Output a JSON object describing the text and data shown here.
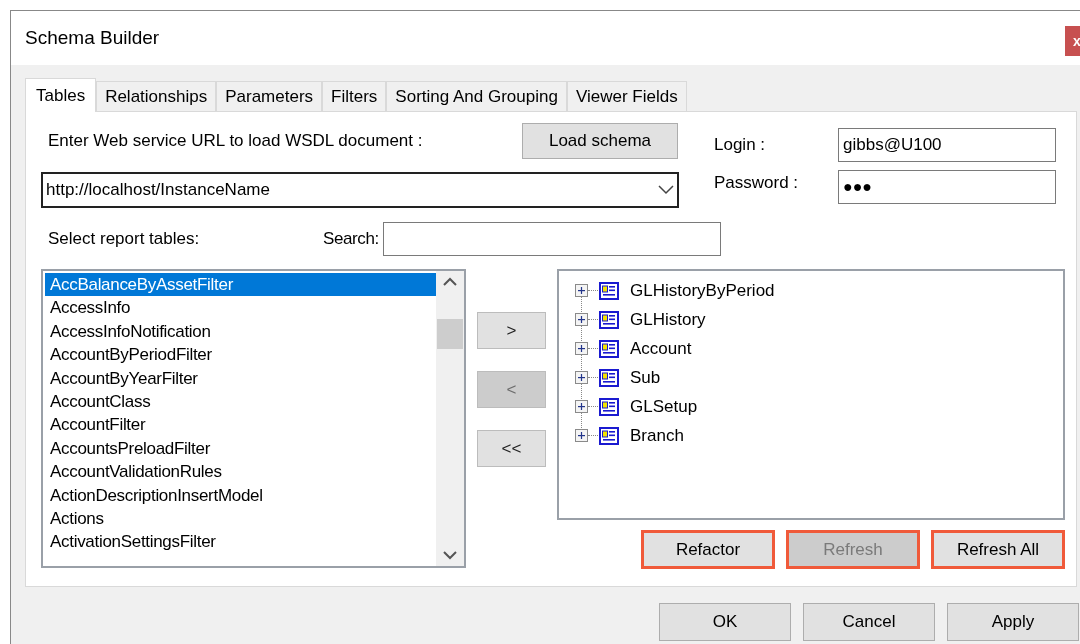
{
  "window": {
    "title": "Schema Builder",
    "close": "x"
  },
  "tabs": [
    {
      "label": "Tables",
      "selected": true
    },
    {
      "label": "Relationships",
      "selected": false
    },
    {
      "label": "Parameters",
      "selected": false
    },
    {
      "label": "Filters",
      "selected": false
    },
    {
      "label": "Sorting And Grouping",
      "selected": false
    },
    {
      "label": "Viewer Fields",
      "selected": false
    }
  ],
  "url_label": "Enter Web service URL to load WSDL document :",
  "load_button": "Load schema",
  "url_value": "http://localhost/InstanceName",
  "login": {
    "label": "Login :",
    "value": "gibbs@U100"
  },
  "password": {
    "label": "Password :",
    "value": "●●●"
  },
  "tables_label": "Select report tables:",
  "search": {
    "label": "Search:"
  },
  "tables": [
    {
      "name": "AccBalanceByAssetFilter",
      "selected": true
    },
    {
      "name": "AccessInfo",
      "selected": false
    },
    {
      "name": "AccessInfoNotification",
      "selected": false
    },
    {
      "name": "AccountByPeriodFilter",
      "selected": false
    },
    {
      "name": "AccountByYearFilter",
      "selected": false
    },
    {
      "name": "AccountClass",
      "selected": false
    },
    {
      "name": "AccountFilter",
      "selected": false
    },
    {
      "name": "AccountsPreloadFilter",
      "selected": false
    },
    {
      "name": "AccountValidationRules",
      "selected": false
    },
    {
      "name": "ActionDescriptionInsertModel",
      "selected": false
    },
    {
      "name": "Actions",
      "selected": false
    },
    {
      "name": "ActivationSettingsFilter",
      "selected": false
    }
  ],
  "move_buttons": [
    {
      "label": ">",
      "disabled": false
    },
    {
      "label": "<",
      "disabled": true
    },
    {
      "label": "<<",
      "disabled": false
    }
  ],
  "tree": [
    {
      "label": "GLHistoryByPeriod",
      "expanded": false
    },
    {
      "label": "GLHistory",
      "expanded": false
    },
    {
      "label": "Account",
      "expanded": false
    },
    {
      "label": "Sub",
      "expanded": false
    },
    {
      "label": "GLSetup",
      "expanded": false
    },
    {
      "label": "Branch",
      "expanded": false
    }
  ],
  "tree_buttons": [
    {
      "label": "Refactor",
      "disabled": false,
      "highlighted": true
    },
    {
      "label": "Refresh",
      "disabled": true,
      "highlighted": true
    },
    {
      "label": "Refresh All",
      "disabled": false,
      "highlighted": true
    }
  ],
  "dialog_buttons": [
    "OK",
    "Cancel",
    "Apply"
  ]
}
